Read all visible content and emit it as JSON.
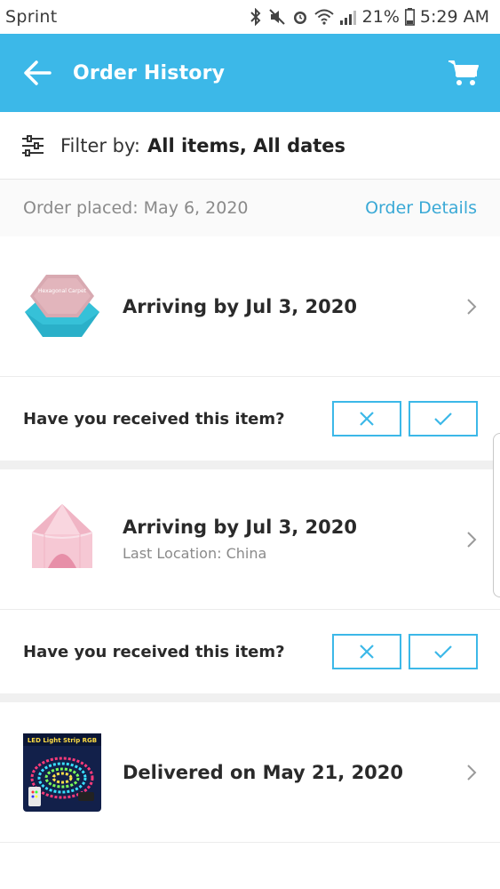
{
  "status_bar": {
    "carrier": "Sprint",
    "battery": "21%",
    "time": "5:29 AM"
  },
  "app_bar": {
    "title": "Order History",
    "back_icon": "arrow-left-icon",
    "cart_icon": "cart-icon",
    "color": "#3cb8e8"
  },
  "filter": {
    "label": "Filter by:",
    "value": "All items, All dates"
  },
  "order": {
    "placed": "Order placed: May 6, 2020",
    "details_link": "Order Details"
  },
  "items": [
    {
      "status": "Arriving by Jul 3, 2020",
      "sub": "",
      "thumb": "hexagonal-carpet",
      "carpet_label": "Hexagonal Carpet"
    },
    {
      "status": "Arriving by Jul 3, 2020",
      "sub": "Last Location: China",
      "thumb": "pink-tent"
    },
    {
      "status": "Delivered on May 21, 2020",
      "sub": "",
      "thumb": "led-strip",
      "led_label": "LED Light Strip RGB"
    }
  ],
  "received": {
    "question": "Have you received this item?"
  }
}
